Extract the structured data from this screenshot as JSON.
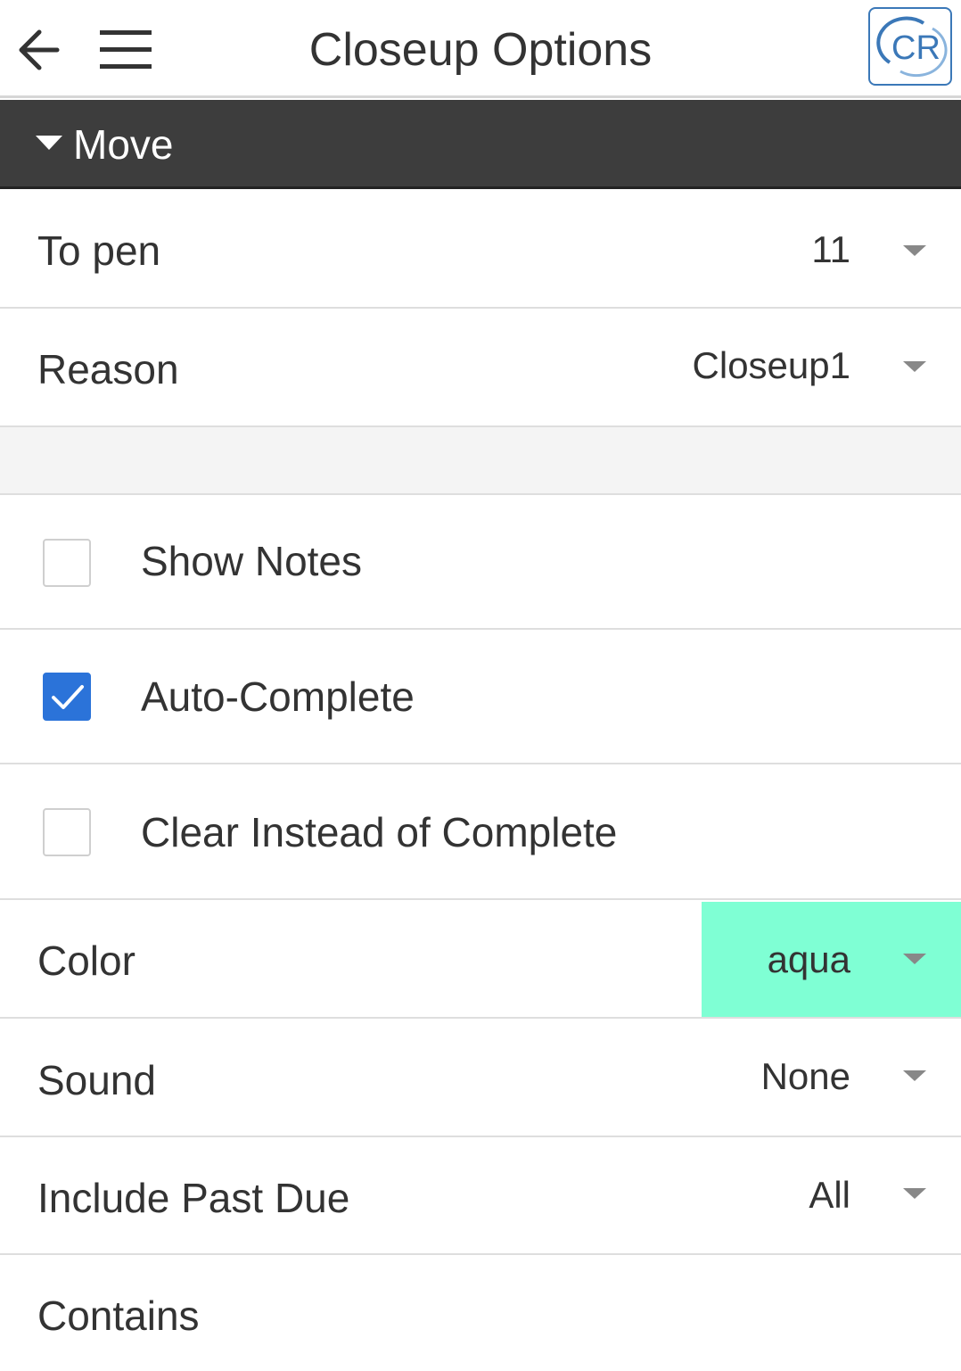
{
  "header": {
    "title": "Closeup Options",
    "back_icon": "arrow-left-icon",
    "menu_icon": "hamburger-menu-icon",
    "logo_text": "CR"
  },
  "section": {
    "label": "Move",
    "icon": "caret-down-icon"
  },
  "fields": {
    "to_pen": {
      "label": "To pen",
      "value": "11"
    },
    "reason": {
      "label": "Reason",
      "value": "Closeup1"
    },
    "color": {
      "label": "Color",
      "value": "aqua",
      "swatch": "#7fffd4"
    },
    "sound": {
      "label": "Sound",
      "value": "None"
    },
    "include_past_due": {
      "label": "Include Past Due",
      "value": "All"
    },
    "contains": {
      "label": "Contains"
    }
  },
  "checkboxes": {
    "show_notes": {
      "label": "Show Notes",
      "checked": false
    },
    "auto_complete": {
      "label": "Auto-Complete",
      "checked": true
    },
    "clear_instead": {
      "label": "Clear Instead of Complete",
      "checked": false
    }
  },
  "colors": {
    "section_bg": "#3d3d3d",
    "checkbox_checked": "#2b73d9",
    "color_swatch": "#7fffd4"
  }
}
